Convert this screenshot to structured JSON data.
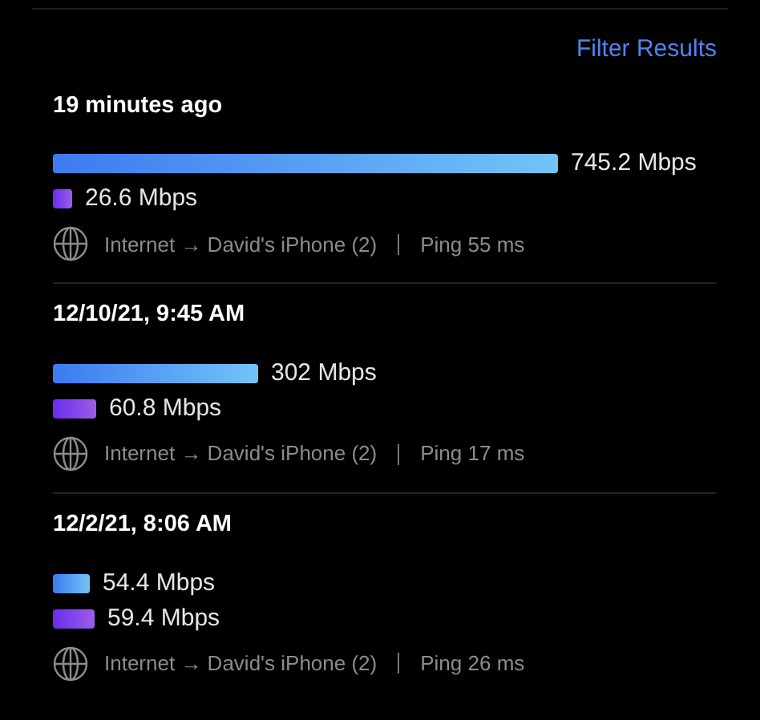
{
  "filter_link": "Filter Results",
  "results": [
    {
      "time": "19 minutes ago",
      "download": {
        "reading": "745.2 Mbps"
      },
      "upload": {
        "reading": "26.6 Mbps"
      },
      "route": "Internet → David's iPhone (2)",
      "ping": "Ping 55 ms"
    },
    {
      "time": "12/10/21, 9:45 AM",
      "download": {
        "reading": "302 Mbps"
      },
      "upload": {
        "reading": "60.8 Mbps"
      },
      "route": "Internet → David's iPhone (2)",
      "ping": "Ping 17 ms"
    },
    {
      "time": "12/2/21, 8:06 AM",
      "download": {
        "reading": "54.4 Mbps"
      },
      "upload": {
        "reading": "59.4 Mbps"
      },
      "route": "Internet → David's iPhone (2)",
      "ping": "Ping 26 ms"
    }
  ]
}
